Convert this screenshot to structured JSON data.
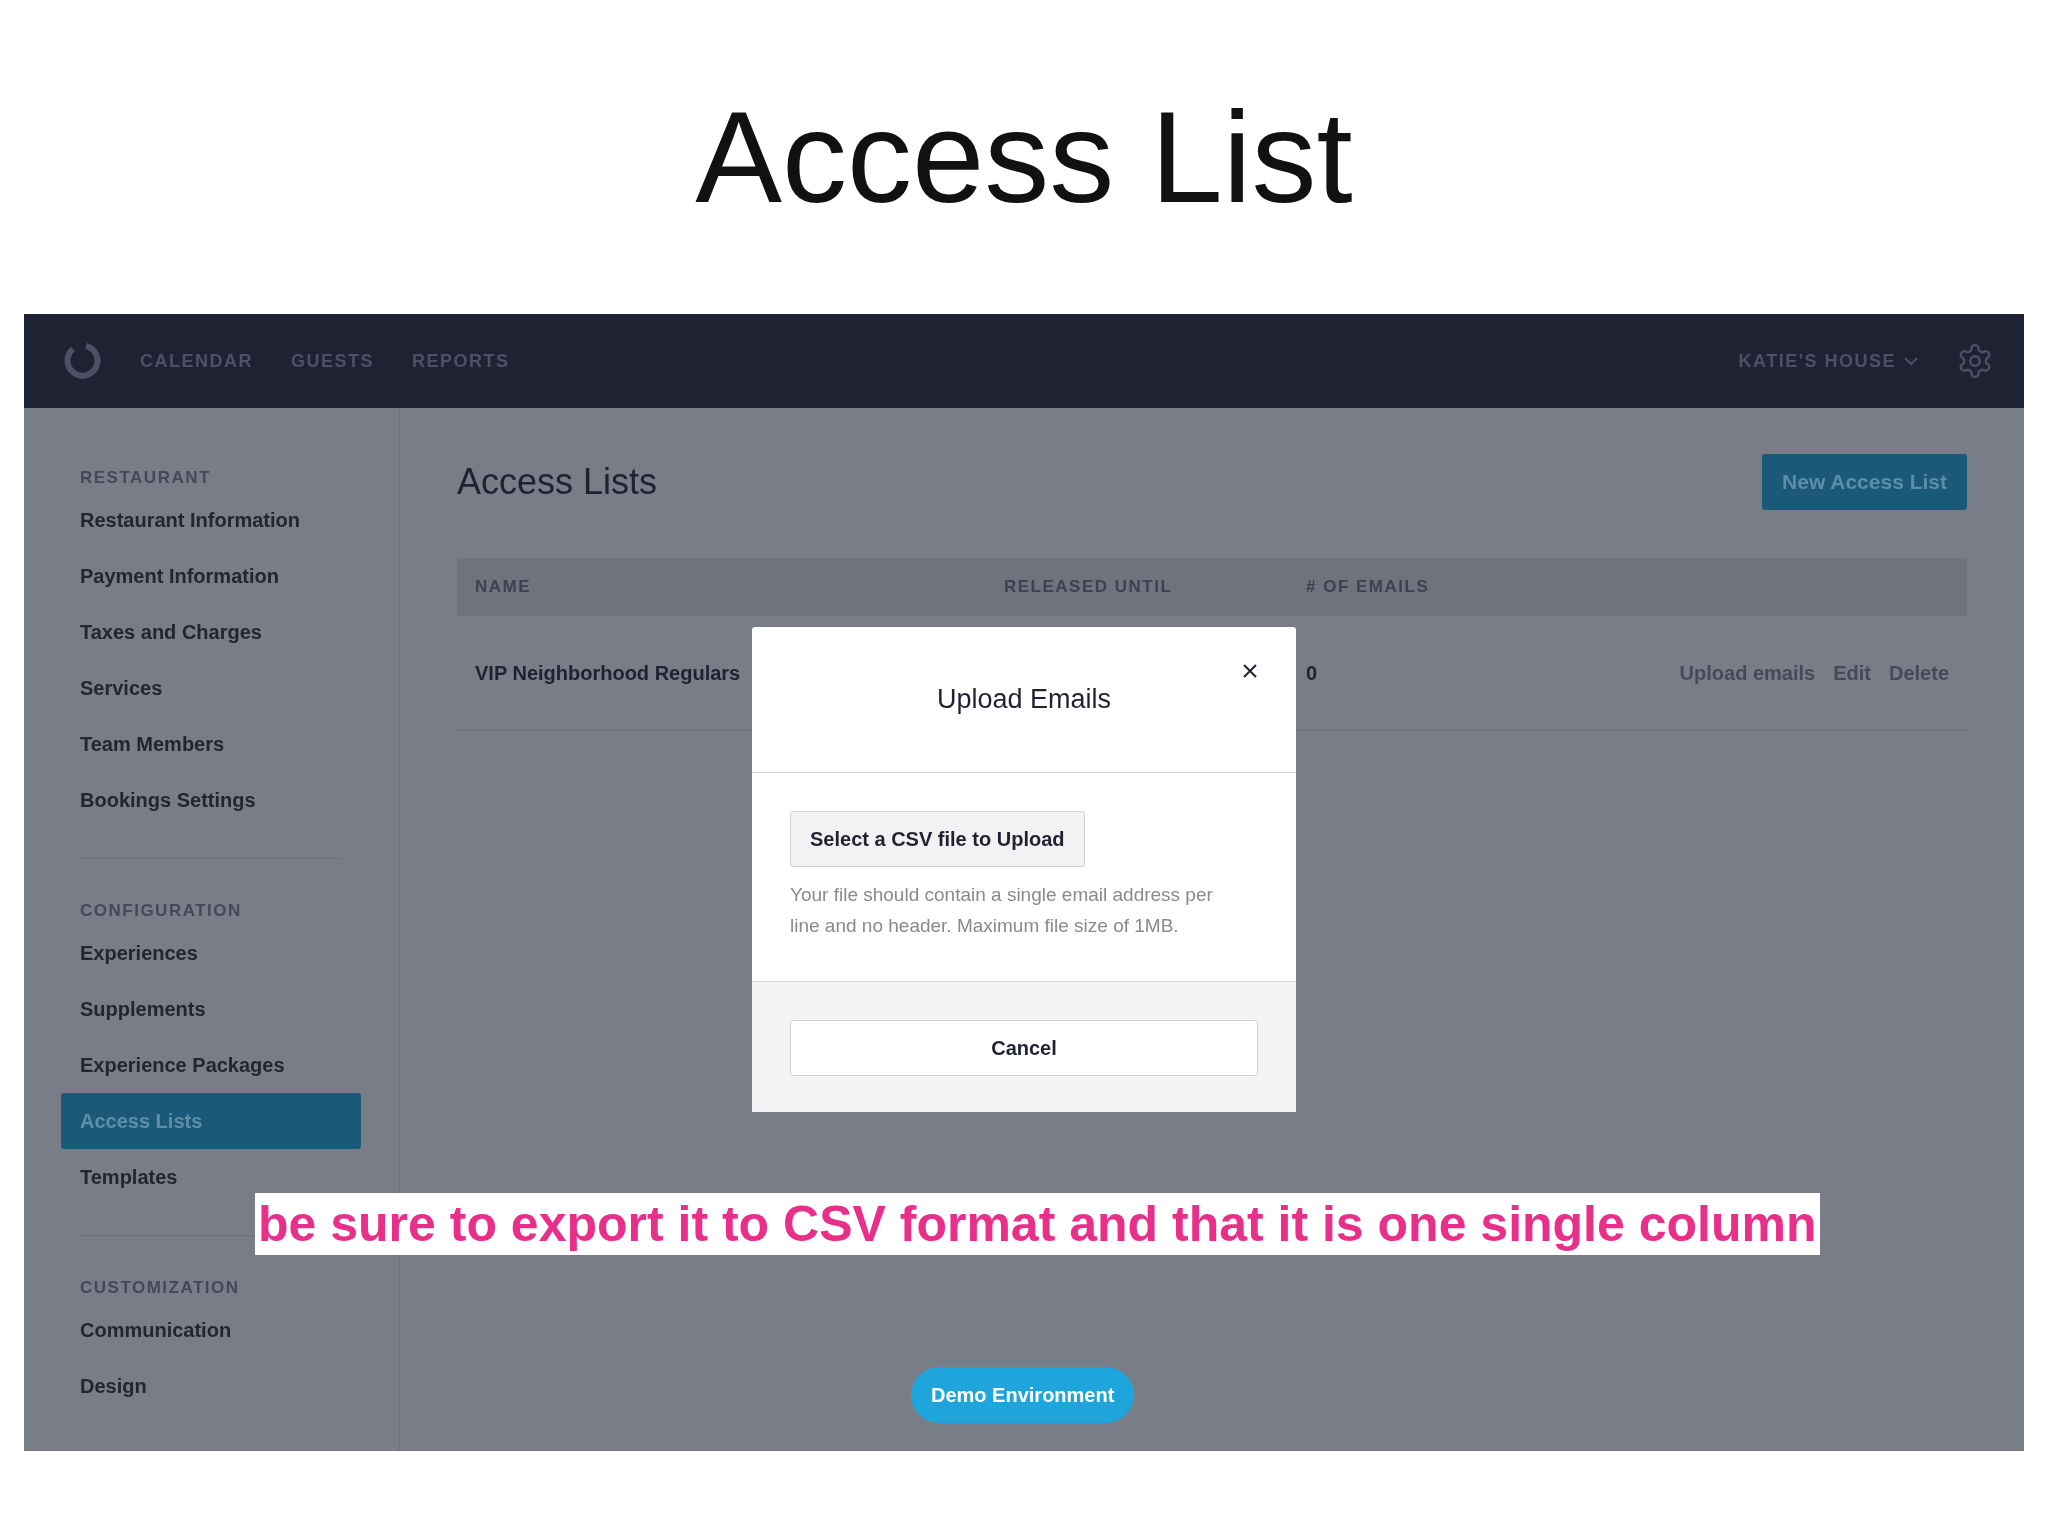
{
  "slide_title": "Access List",
  "nav": {
    "items": [
      "CALENDAR",
      "GUESTS",
      "REPORTS"
    ],
    "venue": "KATIE'S HOUSE"
  },
  "sidebar": [
    {
      "heading": "RESTAURANT",
      "items": [
        {
          "label": "Restaurant Information",
          "selected": false
        },
        {
          "label": "Payment Information",
          "selected": false
        },
        {
          "label": "Taxes and Charges",
          "selected": false
        },
        {
          "label": "Services",
          "selected": false
        },
        {
          "label": "Team Members",
          "selected": false
        },
        {
          "label": "Bookings Settings",
          "selected": false
        }
      ]
    },
    {
      "heading": "CONFIGURATION",
      "items": [
        {
          "label": "Experiences",
          "selected": false
        },
        {
          "label": "Supplements",
          "selected": false
        },
        {
          "label": "Experience Packages",
          "selected": false
        },
        {
          "label": "Access Lists",
          "selected": true
        },
        {
          "label": "Templates",
          "selected": false
        }
      ]
    },
    {
      "heading": "CUSTOMIZATION",
      "items": [
        {
          "label": "Communication",
          "selected": false
        },
        {
          "label": "Design",
          "selected": false
        }
      ]
    }
  ],
  "page": {
    "title": "Access Lists",
    "new_button": "New Access List",
    "table": {
      "columns": [
        "NAME",
        "RELEASED UNTIL",
        "# OF EMAILS"
      ],
      "rows": [
        {
          "name": "VIP Neighborhood Regulars",
          "emails": "0",
          "actions": [
            "Upload emails",
            "Edit",
            "Delete"
          ]
        }
      ]
    }
  },
  "modal": {
    "title": "Upload Emails",
    "select_button": "Select a CSV file to Upload",
    "help": "Your file should contain a single email address per line and no header. Maximum file size of 1MB.",
    "cancel": "Cancel"
  },
  "caption": "be sure to export it to CSV format and that it is one single column",
  "demo_badge": "Demo Environment"
}
